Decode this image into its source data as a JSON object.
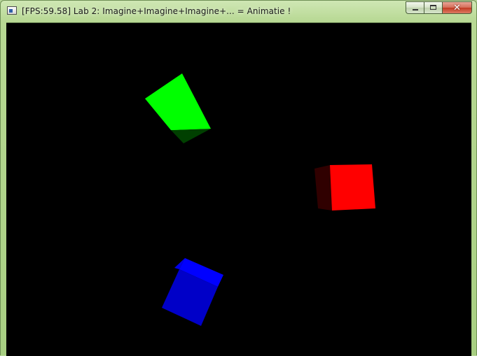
{
  "window": {
    "title": "[FPS:59.58] Lab 2: Imagine+Imagine+Imagine+... = Animatie !",
    "icon": "app-window-icon",
    "buttons": {
      "minimize_icon": "minimize-icon",
      "maximize_icon": "maximize-icon",
      "close_icon": "close-icon",
      "close_glyph": "✕"
    }
  },
  "scene": {
    "background": "#000000",
    "cubes": [
      {
        "name": "green-cube",
        "color": "#00ff00",
        "shade": "#004000"
      },
      {
        "name": "red-cube",
        "color": "#ff0000",
        "shade": "#300000"
      },
      {
        "name": "blue-cube",
        "color": "#0000ff",
        "shade": "#0000c8"
      }
    ]
  }
}
